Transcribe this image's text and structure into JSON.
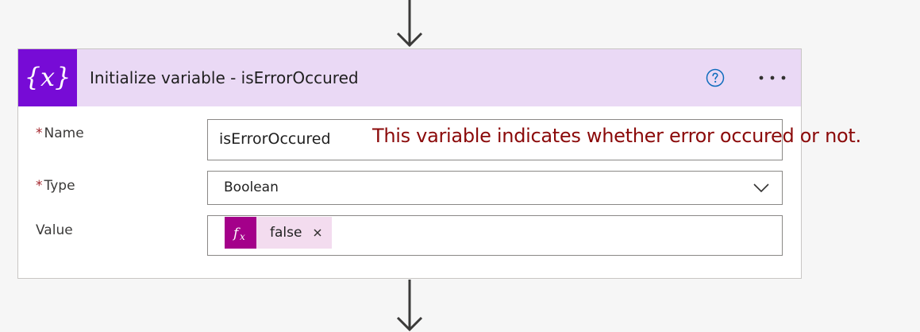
{
  "action": {
    "title": "Initialize variable - isErrorOccured",
    "icon": "variable-braces-icon",
    "header_color": "#ead9f5",
    "icon_tile_color": "#770bd6"
  },
  "fields": {
    "name": {
      "required_marker": "*",
      "label": "Name",
      "value": "isErrorOccured"
    },
    "type": {
      "required_marker": "*",
      "label": "Type",
      "selected": "Boolean"
    },
    "value": {
      "label": "Value",
      "token": {
        "icon": "fx-expression-icon",
        "text": "false",
        "color": "#a4008a"
      }
    }
  },
  "annotation": {
    "text": "This variable indicates whether error occured or not.",
    "color": "#8b0a0a"
  }
}
